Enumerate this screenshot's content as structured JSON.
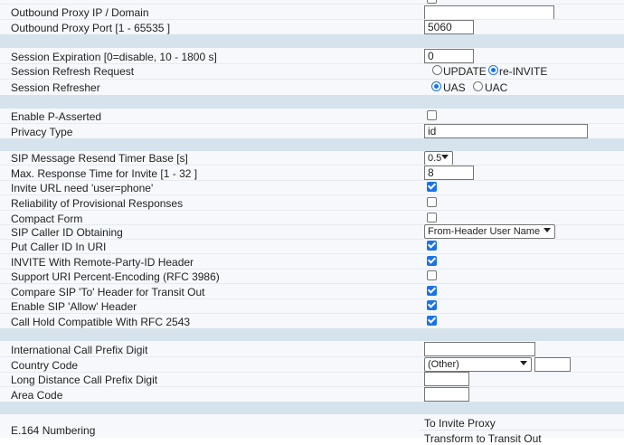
{
  "proxy": {
    "outbound_ip_label": "Outbound Proxy IP / Domain",
    "outbound_ip_value": "",
    "outbound_port_label": "Outbound Proxy Port [1 - 65535 ]",
    "outbound_port_value": "5060"
  },
  "session": {
    "expiration_label": "Session Expiration [0=disable, 10 - 1800 s]",
    "expiration_value": "0",
    "refresh_label": "Session Refresh Request",
    "refresh_options": [
      "UPDATE",
      "re-INVITE"
    ],
    "refresh_selected": "re-INVITE",
    "refresher_label": "Session Refresher",
    "refresher_options": [
      "UAS",
      "UAC"
    ],
    "refresher_selected": "UAS"
  },
  "privacy": {
    "p_asserted_label": "Enable P-Asserted",
    "p_asserted_checked": false,
    "type_label": "Privacy Type",
    "type_value": "id"
  },
  "sip": {
    "resend_timer_label": "SIP Message Resend Timer Base [s]",
    "resend_timer_value": "0.5",
    "max_response_label": "Max. Response Time for Invite [1 - 32 ]",
    "max_response_value": "8",
    "invite_user_phone_label": "Invite URL need 'user=phone'",
    "invite_user_phone_checked": true,
    "reliability_label": "Reliability of Provisional Responses",
    "reliability_checked": false,
    "compact_label": "Compact Form",
    "compact_checked": false,
    "caller_id_label": "SIP Caller ID Obtaining",
    "caller_id_value": "From-Header User Name",
    "put_caller_id_label": "Put Caller ID In URI",
    "put_caller_id_checked": true,
    "remote_party_label": "INVITE With Remote-Party-ID Header",
    "remote_party_checked": true,
    "percent_enc_label": "Support URI Percent-Encoding (RFC 3986)",
    "percent_enc_checked": false,
    "compare_to_label": "Compare SIP 'To' Header for Transit Out",
    "compare_to_checked": true,
    "allow_label": "Enable SIP 'Allow' Header",
    "allow_checked": true,
    "call_hold_label": "Call Hold Compatible With RFC 2543",
    "call_hold_checked": true
  },
  "dialing": {
    "intl_prefix_label": "International Call Prefix Digit",
    "intl_prefix_value": "",
    "country_code_label": "Country Code",
    "country_code_value": "(Other)",
    "country_code_extra": "",
    "long_distance_label": "Long Distance Call Prefix Digit",
    "long_distance_value": "",
    "area_code_label": "Area Code",
    "area_code_value": ""
  },
  "e164": {
    "label": "E.164 Numbering",
    "to_invite_proxy": "To Invite Proxy",
    "transform_transit_out": "Transform to Transit Out"
  },
  "colors": {
    "accent": "#1a73e8",
    "separator": "#d6e3ec",
    "row_bg": "#f6f8fb"
  }
}
